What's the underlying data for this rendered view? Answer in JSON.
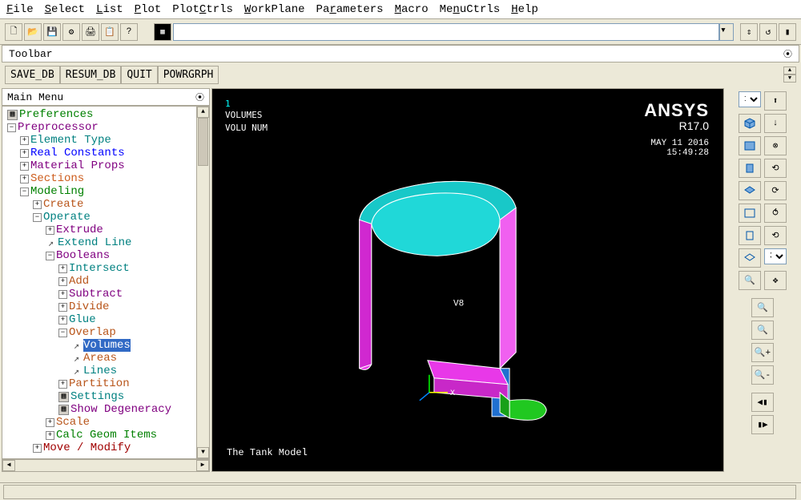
{
  "menubar": [
    "File",
    "Select",
    "List",
    "Plot",
    "PlotCtrls",
    "WorkPlane",
    "Parameters",
    "Macro",
    "MenuCtrls",
    "Help"
  ],
  "toolbar_label": "Toolbar",
  "custom_buttons": [
    "SAVE_DB",
    "RESUM_DB",
    "QUIT",
    "POWRGRPH"
  ],
  "main_menu_title": "Main Menu",
  "tree": [
    {
      "lvl": 0,
      "box": "",
      "glyph": "doc",
      "label": "Preferences",
      "cls": "c-pref"
    },
    {
      "lvl": 0,
      "box": "−",
      "glyph": "",
      "label": "Preprocessor",
      "cls": "c-prep"
    },
    {
      "lvl": 1,
      "box": "+",
      "glyph": "",
      "label": "Element Type",
      "cls": "c-et"
    },
    {
      "lvl": 1,
      "box": "+",
      "glyph": "",
      "label": "Real Constants",
      "cls": "c-rc"
    },
    {
      "lvl": 1,
      "box": "+",
      "glyph": "",
      "label": "Material Props",
      "cls": "c-mp"
    },
    {
      "lvl": 1,
      "box": "+",
      "glyph": "",
      "label": "Sections",
      "cls": "c-sec"
    },
    {
      "lvl": 1,
      "box": "−",
      "glyph": "",
      "label": "Modeling",
      "cls": "c-mod"
    },
    {
      "lvl": 2,
      "box": "+",
      "glyph": "",
      "label": "Create",
      "cls": "c-cr"
    },
    {
      "lvl": 2,
      "box": "−",
      "glyph": "",
      "label": "Operate",
      "cls": "c-op"
    },
    {
      "lvl": 3,
      "box": "+",
      "glyph": "",
      "label": "Extrude",
      "cls": "c-ex"
    },
    {
      "lvl": 3,
      "box": "",
      "glyph": "arrow",
      "label": "Extend Line",
      "cls": "c-el"
    },
    {
      "lvl": 3,
      "box": "−",
      "glyph": "",
      "label": "Booleans",
      "cls": "c-bo"
    },
    {
      "lvl": 4,
      "box": "+",
      "glyph": "",
      "label": "Intersect",
      "cls": "c-in"
    },
    {
      "lvl": 4,
      "box": "+",
      "glyph": "",
      "label": "Add",
      "cls": "c-ad"
    },
    {
      "lvl": 4,
      "box": "+",
      "glyph": "",
      "label": "Subtract",
      "cls": "c-su"
    },
    {
      "lvl": 4,
      "box": "+",
      "glyph": "",
      "label": "Divide",
      "cls": "c-di"
    },
    {
      "lvl": 4,
      "box": "+",
      "glyph": "",
      "label": "Glue",
      "cls": "c-gl"
    },
    {
      "lvl": 4,
      "box": "−",
      "glyph": "",
      "label": "Overlap",
      "cls": "c-ov"
    },
    {
      "lvl": 5,
      "box": "",
      "glyph": "arrow",
      "label": "Volumes",
      "cls": "c-vo"
    },
    {
      "lvl": 5,
      "box": "",
      "glyph": "arrow",
      "label": "Areas",
      "cls": "c-ar"
    },
    {
      "lvl": 5,
      "box": "",
      "glyph": "arrow",
      "label": "Lines",
      "cls": "c-li"
    },
    {
      "lvl": 4,
      "box": "+",
      "glyph": "",
      "label": "Partition",
      "cls": "c-pa"
    },
    {
      "lvl": 4,
      "box": "",
      "glyph": "doc",
      "label": "Settings",
      "cls": "c-se"
    },
    {
      "lvl": 4,
      "box": "",
      "glyph": "doc",
      "label": "Show Degeneracy",
      "cls": "c-sd"
    },
    {
      "lvl": 3,
      "box": "+",
      "glyph": "",
      "label": "Scale",
      "cls": "c-sc"
    },
    {
      "lvl": 3,
      "box": "+",
      "glyph": "",
      "label": "Calc Geom Items",
      "cls": "c-cg"
    },
    {
      "lvl": 2,
      "box": "+",
      "glyph": "",
      "label": "Move / Modify",
      "cls": "c-mm"
    }
  ],
  "viewport": {
    "window_num": "1",
    "label1": "VOLUMES",
    "label2": "VOLU NUM",
    "logo": "ANSYS",
    "version": "R17.0",
    "date": "MAY 11 2016",
    "time": "15:49:28",
    "vol_label": "V8",
    "axis_x": "X",
    "model_title": "The Tank Model"
  },
  "right_panel": {
    "win_sel": "1",
    "num_sel": "3"
  },
  "cmd_value": ""
}
